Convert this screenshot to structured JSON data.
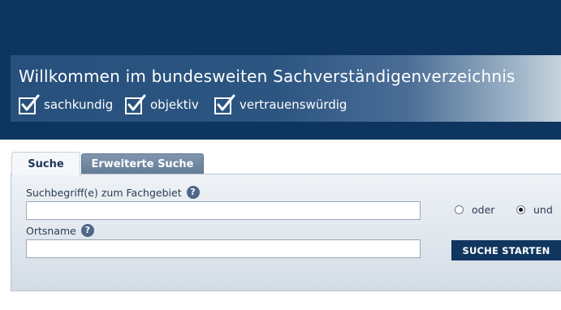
{
  "header": {
    "title": "Willkommen im bundesweiten Sachverständigenverzeichnis",
    "claims": [
      {
        "label": "sachkundig",
        "icon": "checkbox-check-icon"
      },
      {
        "label": "objektiv",
        "icon": "checkbox-check-icon"
      },
      {
        "label": "vertrauenswürdig",
        "icon": "checkbox-check-icon"
      }
    ]
  },
  "tabs": [
    {
      "label": "Suche",
      "active": true
    },
    {
      "label": "Erweiterte Suche",
      "active": false
    }
  ],
  "search": {
    "term_label": "Suchbegriff(e) zum Fachgebiet",
    "term_value": "",
    "term_placeholder": "",
    "location_label": "Ortsname",
    "location_value": "",
    "location_placeholder": "",
    "help_glyph": "?",
    "mode_options": [
      {
        "label": "oder",
        "selected": false
      },
      {
        "label": "und",
        "selected": true
      }
    ],
    "submit_label": "SUCHE STARTEN"
  },
  "colors": {
    "header_bg": "#0d3560",
    "hero_bg": "#27507c",
    "button_bg": "#10365f",
    "tab_inactive_bg": "#6f879f",
    "panel_bg": "#e3e9ef"
  }
}
